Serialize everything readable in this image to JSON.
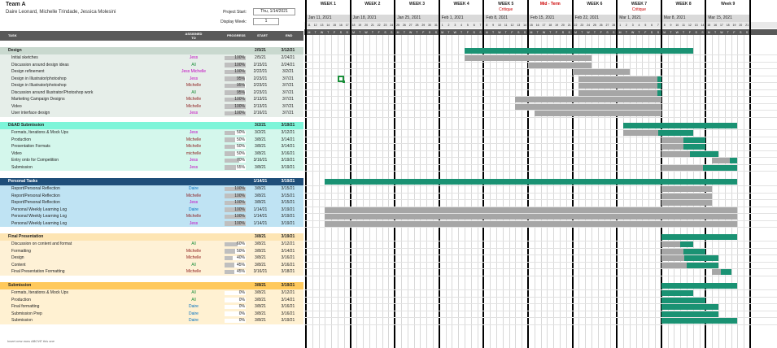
{
  "header": {
    "team": "Team A",
    "members": "Daire Leonard,  Michelle Trindade, Jessica Molesini",
    "project_start_label": "Project Start:",
    "project_start_value": "Thu, 1/14/2021",
    "display_week_label": "Display Week:",
    "display_week_value": "1"
  },
  "columns": {
    "task": "TASK",
    "assigned": "ASSIGNED TO",
    "progress": "PROGRESS",
    "start": "START",
    "end": "END"
  },
  "timeline": {
    "weeks": [
      {
        "label": "WEEK 1",
        "sub": "",
        "date": "Jan 11, 2021"
      },
      {
        "label": "WEEK 2",
        "sub": "",
        "date": "Jan 18, 2021"
      },
      {
        "label": "WEEK 3",
        "sub": "",
        "date": "Jan 25, 2021"
      },
      {
        "label": "WEEK 4",
        "sub": "",
        "date": "Feb 1, 2021"
      },
      {
        "label": "WEEK 5",
        "sub": "Critique",
        "date": "Feb 8, 2021"
      },
      {
        "label": "Mid - Term",
        "sub": "",
        "date": "Feb 15, 2021"
      },
      {
        "label": "WEEK 6",
        "sub": "",
        "date": "Feb 22, 2021"
      },
      {
        "label": "WEEK 7",
        "sub": "Critique",
        "date": "Mar 1, 2021"
      },
      {
        "label": "WEEK 8",
        "sub": "",
        "date": "Mar 8, 2021"
      },
      {
        "label": "Week 9",
        "sub": "",
        "date": "Mar 15, 2021"
      }
    ],
    "day_numbers": [
      "11",
      "12",
      "13",
      "14",
      "15",
      "16",
      "17",
      "18",
      "19",
      "20",
      "21",
      "22",
      "23",
      "24",
      "25",
      "26",
      "27",
      "28",
      "29",
      "30",
      "31",
      "1",
      "2",
      "3",
      "4",
      "5",
      "6",
      "7",
      "8",
      "9",
      "10",
      "11",
      "12",
      "13",
      "14",
      "15",
      "16",
      "17",
      "18",
      "19",
      "20",
      "21",
      "22",
      "23",
      "24",
      "25",
      "26",
      "27",
      "28",
      "1",
      "2",
      "3",
      "4",
      "5",
      "6",
      "7",
      "8",
      "9",
      "10",
      "11",
      "12",
      "13",
      "14",
      "15",
      "16",
      "17",
      "18",
      "19",
      "20",
      "21"
    ],
    "day_letters": [
      "M",
      "T",
      "W",
      "T",
      "F",
      "S",
      "S"
    ]
  },
  "sections": [
    {
      "name": "Design",
      "start": "2/5/21",
      "end": "3/12/21",
      "bg": "#c9d9cf",
      "row_bg": "#e6eee9",
      "bar_start": "2/5/21",
      "bar_end": "3/12/21",
      "bar_color": "#1a9273",
      "tasks": [
        {
          "task": "Initial sketches",
          "assigned": "Jess",
          "color": "#c000c0",
          "progress": 100,
          "progress_text": "100%",
          "start": "2/5/21",
          "end": "2/24/21"
        },
        {
          "task": "Discussion around design ideas",
          "assigned": "All",
          "color": "#1d8f3c",
          "progress": 100,
          "progress_text": "100%",
          "start": "2/15/21",
          "end": "2/24/21"
        },
        {
          "task": "Design refinement",
          "assigned": "Jess Michelle",
          "color": "#c000c0",
          "progress": 100,
          "progress_text": "100%",
          "start": "2/22/21",
          "end": "3/2/21"
        },
        {
          "task": "Design in Illustrator/photoshop",
          "assigned": "Jess",
          "color": "#c000c0",
          "progress": 95,
          "progress_text": "95%",
          "start": "2/23/21",
          "end": "3/7/21"
        },
        {
          "task": "Design in Illustrator/photoshop",
          "assigned": "Michelle",
          "color": "#8b1a1a",
          "progress": 95,
          "progress_text": "95%",
          "start": "2/23/21",
          "end": "3/7/21"
        },
        {
          "task": "Discussion around Illustrator/Photoshop work",
          "assigned": "All",
          "color": "#1d8f3c",
          "progress": 95,
          "progress_text": "95%",
          "start": "2/23/21",
          "end": "3/7/21"
        },
        {
          "task": "Marketing Campaign Designs",
          "assigned": "Michelle",
          "color": "#8b1a1a",
          "progress": 100,
          "progress_text": "100%",
          "start": "2/13/21",
          "end": "3/7/21"
        },
        {
          "task": "Video",
          "assigned": "Michelle",
          "color": "#8b1a1a",
          "progress": 100,
          "progress_text": "100%",
          "start": "2/13/21",
          "end": "3/7/21"
        },
        {
          "task": "User interface design",
          "assigned": "Jess",
          "color": "#c000c0",
          "progress": 100,
          "progress_text": "100%",
          "start": "2/16/21",
          "end": "3/7/21"
        }
      ]
    },
    {
      "name": "D&AD Submission",
      "start": "3/2/21",
      "end": "3/19/21",
      "bg": "#7df5d9",
      "row_bg": "#d4f7ec",
      "bar_start": "3/2/21",
      "bar_end": "3/19/21",
      "bar_color": "#1a9273",
      "tasks": [
        {
          "task": "Formats, Iterations & Mock Ups",
          "assigned": "Jess",
          "color": "#c000c0",
          "progress": 50,
          "progress_text": "50%",
          "start": "3/2/21",
          "end": "3/12/21"
        },
        {
          "task": "Production",
          "assigned": "Michelle",
          "color": "#8b1a1a",
          "progress": 50,
          "progress_text": "50%",
          "start": "3/8/21",
          "end": "3/14/21"
        },
        {
          "task": "Presentation Formats",
          "assigned": "Michelle",
          "color": "#8b1a1a",
          "progress": 50,
          "progress_text": "50%",
          "start": "3/8/21",
          "end": "3/14/21"
        },
        {
          "task": "Video",
          "assigned": "michelle",
          "color": "#8b1a1a",
          "progress": 50,
          "progress_text": "50%",
          "start": "3/8/21",
          "end": "3/16/21"
        },
        {
          "task": "Entry onto for Competition",
          "assigned": "Jess",
          "color": "#c000c0",
          "progress": 70,
          "progress_text": "70%",
          "start": "3/16/21",
          "end": "3/19/21"
        },
        {
          "task": "Submission",
          "assigned": "Jess",
          "color": "#c000c0",
          "progress": 55,
          "progress_text": "55%",
          "start": "3/8/21",
          "end": "3/19/21"
        }
      ]
    },
    {
      "name": "Personal Tasks",
      "start": "1/14/21",
      "end": "3/19/21",
      "bg": "#1f4e79",
      "row_bg": "#bfe3f3",
      "header_text_color": "#ffffff",
      "bar_start": "1/14/21",
      "bar_end": "3/19/21",
      "bar_color": "#1a9273",
      "tasks": [
        {
          "task": "Report/Personal Reflection",
          "assigned": "Daire",
          "color": "#0070c0",
          "progress": 100,
          "progress_text": "100%",
          "start": "3/8/21",
          "end": "3/15/21"
        },
        {
          "task": "Report/Personal Reflection",
          "assigned": "Michelle",
          "color": "#8b1a1a",
          "progress": 100,
          "progress_text": "100%",
          "start": "3/8/21",
          "end": "3/15/21"
        },
        {
          "task": "Report/Personal Reflection",
          "assigned": "Jess",
          "color": "#c000c0",
          "progress": 100,
          "progress_text": "100%",
          "start": "3/8/21",
          "end": "3/15/21"
        },
        {
          "task": "Personal Weekly Learning Log",
          "assigned": "Daire",
          "color": "#0070c0",
          "progress": 100,
          "progress_text": "100%",
          "start": "1/14/21",
          "end": "3/19/21"
        },
        {
          "task": "Personal Weekly Learning Log",
          "assigned": "Michelle",
          "color": "#8b1a1a",
          "progress": 100,
          "progress_text": "100%",
          "start": "1/14/21",
          "end": "3/19/21"
        },
        {
          "task": "Personal Weekly Learning Log",
          "assigned": "Jess",
          "color": "#c000c0",
          "progress": 100,
          "progress_text": "100%",
          "start": "1/14/21",
          "end": "3/19/21"
        }
      ]
    },
    {
      "name": "Final Presentation",
      "start": "3/8/21",
      "end": "3/19/21",
      "bg": "#fde5b4",
      "row_bg": "#fef1d6",
      "bar_start": "3/8/21",
      "bar_end": "3/19/21",
      "bar_color": "#1a9273",
      "tasks": [
        {
          "task": "Discussion on content and format",
          "assigned": "All",
          "color": "#1d8f3c",
          "progress": 60,
          "progress_text": "60%",
          "start": "3/8/21",
          "end": "3/12/21"
        },
        {
          "task": "Formatting",
          "assigned": "Michelle",
          "color": "#8b1a1a",
          "progress": 50,
          "progress_text": "50%",
          "start": "3/8/21",
          "end": "3/14/21"
        },
        {
          "task": "Design",
          "assigned": "Michelle",
          "color": "#8b1a1a",
          "progress": 40,
          "progress_text": "40%",
          "start": "3/8/21",
          "end": "3/16/21"
        },
        {
          "task": "Content",
          "assigned": "All",
          "color": "#1d8f3c",
          "progress": 45,
          "progress_text": "45%",
          "start": "3/8/21",
          "end": "3/16/21"
        },
        {
          "task": "Final Presentation Formatting",
          "assigned": "Michelle",
          "color": "#8b1a1a",
          "progress": 45,
          "progress_text": "45%",
          "start": "3/16/21",
          "end": "3/18/21"
        }
      ]
    },
    {
      "name": "Submission",
      "start": "3/8/21",
      "end": "3/19/21",
      "bg": "#ffc95c",
      "row_bg": "#fff1d2",
      "bar_start": "3/8/21",
      "bar_end": "3/19/21",
      "bar_color": "#1a9273",
      "tasks": [
        {
          "task": "Formats, Iterations & Mock Ups",
          "assigned": "All",
          "color": "#1d8f3c",
          "progress": 0,
          "progress_text": "0%",
          "start": "3/8/21",
          "end": "3/12/21"
        },
        {
          "task": "Production",
          "assigned": "All",
          "color": "#1d8f3c",
          "progress": 0,
          "progress_text": "0%",
          "start": "3/8/21",
          "end": "3/14/21"
        },
        {
          "task": "Final formatting",
          "assigned": "Daire",
          "color": "#0070c0",
          "progress": 0,
          "progress_text": "0%",
          "start": "3/8/21",
          "end": "3/16/21"
        },
        {
          "task": "Submission Prep",
          "assigned": "Daire",
          "color": "#0070c0",
          "progress": 0,
          "progress_text": "0%",
          "start": "3/8/21",
          "end": "3/16/21"
        },
        {
          "task": "Submission",
          "assigned": "Daire",
          "color": "#0070c0",
          "progress": 0,
          "progress_text": "0%",
          "start": "3/8/21",
          "end": "3/19/21"
        }
      ]
    }
  ],
  "footer_note": "Insert new rows ABOVE this one"
}
